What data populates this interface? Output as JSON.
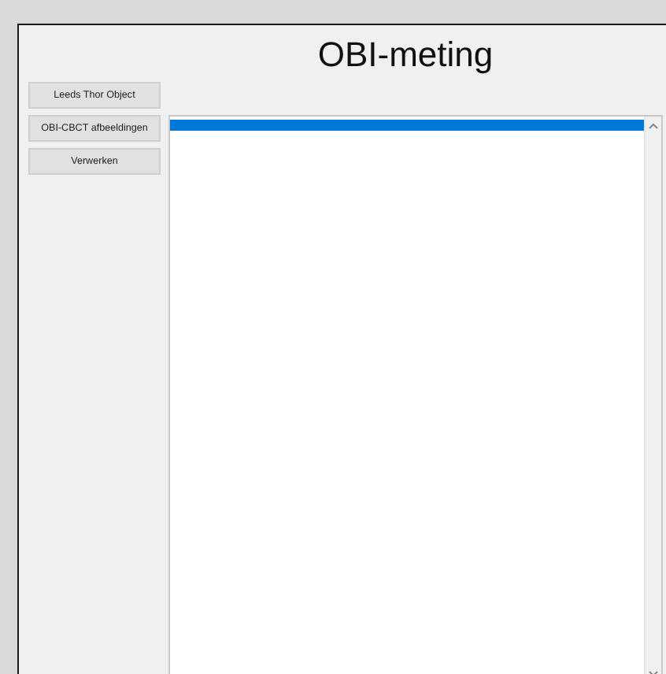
{
  "window": {
    "title": "OBI-meting"
  },
  "buttons": [
    {
      "label": "Leeds Thor Object"
    },
    {
      "label": "OBI-CBCT afbeeldingen"
    },
    {
      "label": "Verwerken"
    }
  ],
  "list": {
    "rows": [
      {
        "selected": true
      }
    ]
  }
}
